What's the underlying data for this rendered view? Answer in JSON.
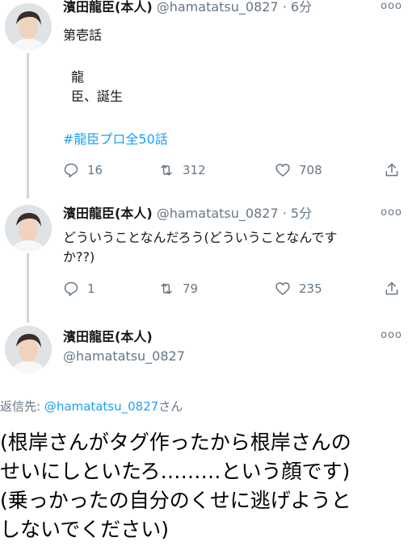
{
  "tweets": [
    {
      "name": "濱田龍臣(本人)",
      "handle": "@hamatatsu_0827",
      "time": "· 6分",
      "more": "ooo",
      "text_line1": "第壱話",
      "text_line2": "龍",
      "text_line3": "臣、誕生",
      "hashtag": "#龍臣プロ全50話",
      "reply_count": "16",
      "retweet_count": "312",
      "like_count": "708"
    },
    {
      "name": "濱田龍臣(本人)",
      "handle": "@hamatatsu_0827",
      "time": "· 5分",
      "more": "ooo",
      "text_line1": "どういうことなんだろう(どういうことなんです",
      "text_line2": "か??)",
      "reply_count": "1",
      "retweet_count": "79",
      "like_count": "235"
    }
  ],
  "main_tweet": {
    "name": "濱田龍臣(本人)",
    "handle": "@hamatatsu_0827",
    "more": "ooo",
    "reply_label": "返信先: ",
    "reply_mention": "@hamatatsu_0827",
    "reply_suffix": "さん",
    "line1": "(根岸さんがタグ作ったから根岸さんの",
    "line2": "せいにしといたろ………という顔です)",
    "line3": "(乗っかったの自分のくせに逃げようと",
    "line4": "しないでください)"
  },
  "icons": [
    "reply-icon",
    "retweet-icon",
    "like-icon",
    "share-icon",
    "more-icon"
  ],
  "colors": {
    "link": "#1da1f2",
    "muted": "#657786",
    "thread": "#ccd6dd"
  }
}
